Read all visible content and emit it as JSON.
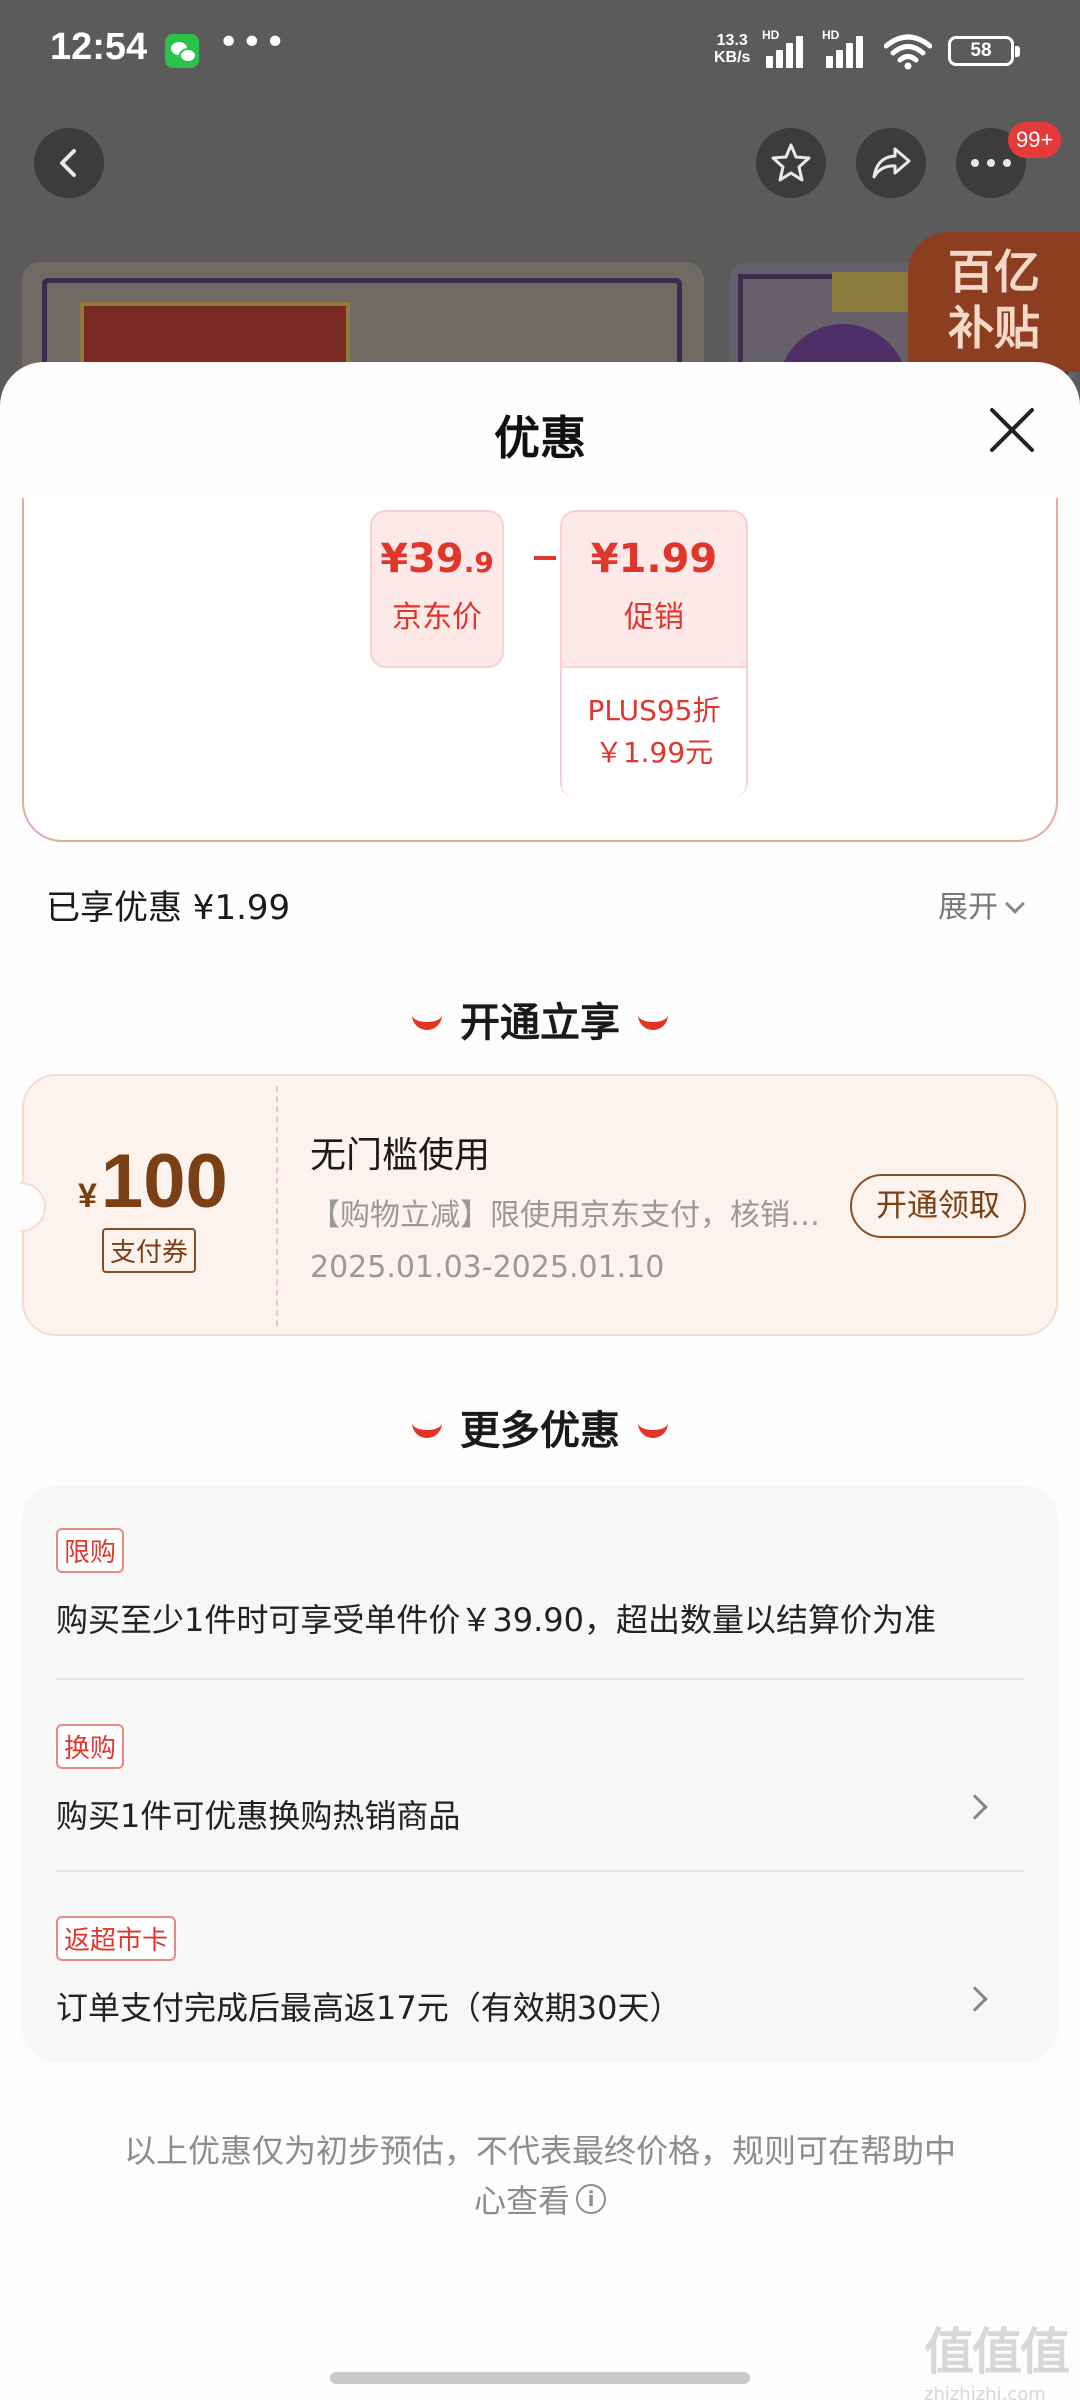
{
  "status_bar": {
    "time": "12:54",
    "more": "•••",
    "net_speed_value": "13.3",
    "net_speed_unit": "KB/s",
    "sim1_label": "HD",
    "sim2_label": "HD",
    "battery": "58"
  },
  "nav": {
    "badge": "99+"
  },
  "background": {
    "subsidy_line1": "百亿",
    "subsidy_line2": "补贴"
  },
  "sheet": {
    "title": "优惠"
  },
  "formula": {
    "jd_price_main": "¥39",
    "jd_price_decimal": ".9",
    "jd_price_label": "京东价",
    "operator": "−",
    "promo_amount": "¥1.99",
    "promo_label": "促销",
    "promo_detail_line1": "PLUS95折",
    "promo_detail_line2": "￥1.99元"
  },
  "enjoyed": {
    "text": "已享优惠 ¥1.99",
    "expand_label": "展开"
  },
  "open_section": {
    "title": "开通立享"
  },
  "coupon": {
    "currency": "¥",
    "value": "100",
    "tag": "支付券",
    "title": "无门槛使用",
    "description": "【购物立减】限使用京东支付，核销后不可退回",
    "date_range": "2025.01.03-2025.01.10",
    "button_label": "开通领取"
  },
  "more_section": {
    "title": "更多优惠",
    "offers": [
      {
        "tag": "限购",
        "text": "购买至少1件时可享受单件价￥39.90，超出数量以结算价为准",
        "has_arrow": false
      },
      {
        "tag": "换购",
        "text": "购买1件可优惠换购热销商品",
        "has_arrow": true
      },
      {
        "tag": "返超市卡",
        "text": "订单支付完成后最高返17元（有效期30天）",
        "has_arrow": true
      }
    ]
  },
  "disclaimer": {
    "text": "以上优惠仅为初步预估，不代表最终价格，规则可在帮助中心查看"
  },
  "watermark": {
    "logo": "值值值",
    "url": "zhizhizhi.com"
  },
  "colors": {
    "accent_red": "#e0362c",
    "coupon_brown": "#7a3f12",
    "coupon_bg": "#fdf3ee"
  },
  "icons": [
    "back-arrow-icon",
    "star-icon",
    "share-icon",
    "more-icon",
    "close-icon",
    "chevron-down-icon",
    "chevron-right-icon",
    "info-icon",
    "wechat-icon",
    "wifi-icon",
    "signal-icon",
    "battery-icon"
  ]
}
